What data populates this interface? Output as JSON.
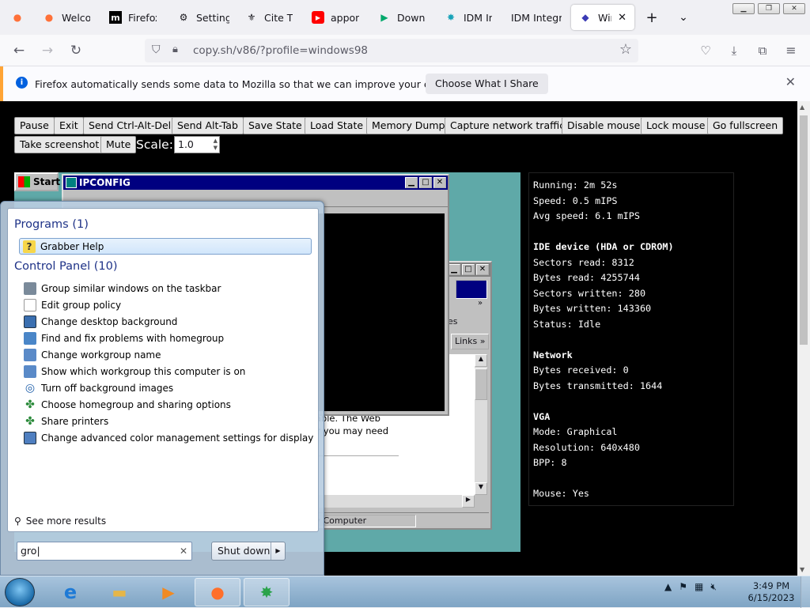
{
  "browser": {
    "tabs": [
      {
        "title": "",
        "icon": "firefox-icon",
        "active": false
      },
      {
        "title": "Welcom",
        "icon": "firefox-icon",
        "active": false
      },
      {
        "title": "Firefox",
        "icon": "mdn-icon",
        "active": false
      },
      {
        "title": "Settings",
        "icon": "gear-icon",
        "active": false
      },
      {
        "title": "Cite Th",
        "icon": "cite-icon",
        "active": false
      },
      {
        "title": "appon",
        "icon": "youtube-icon",
        "active": false
      },
      {
        "title": "Downlo",
        "icon": "play-icon",
        "active": false
      },
      {
        "title": "IDM Ini",
        "icon": "idm-icon",
        "active": false
      },
      {
        "title": "IDM Integra",
        "icon": "",
        "active": false
      },
      {
        "title": "Wind",
        "icon": "v86-icon",
        "active": true
      }
    ],
    "new_tab": "+",
    "url": "copy.sh/v86/?profile=windows98",
    "notification": {
      "message": "Firefox automatically sends some data to Mozilla so that we can improve your experience.",
      "button": "Choose What I Share"
    }
  },
  "emulator": {
    "controls": [
      "Pause",
      "Exit",
      "Send Ctrl-Alt-Del",
      "Send Alt-Tab",
      "Save State",
      "Load State",
      "Memory Dump",
      "Capture network traffic",
      "Disable mouse",
      "Lock mouse",
      "Go fullscreen",
      "Take screenshot",
      "Mute"
    ],
    "scale_label": "Scale:",
    "scale_value": "1.0",
    "win98": {
      "start_label": "Start",
      "ipconfig_title": "IPCONFIG",
      "links_label": "Links",
      "ie_text_1": "rently unavailable. The Web",
      "ie_text_2": "l difficulties, or you may need",
      "es_label": "es",
      "status_zone": "My Computer"
    },
    "stats": {
      "running": "Running: 2m 52s",
      "speed": "Speed: 0.5 mIPS",
      "avg_speed": "Avg speed: 6.1 mIPS",
      "ide_header": "IDE device (HDA or CDROM)",
      "sectors_read": "Sectors read: 8312",
      "bytes_read": "Bytes read: 4255744",
      "sectors_written": "Sectors written: 280",
      "bytes_written": "Bytes written: 143360",
      "status": "Status: Idle",
      "network_header": "Network",
      "bytes_received": "Bytes received: 0",
      "bytes_transmitted": "Bytes transmitted: 1644",
      "vga_header": "VGA",
      "mode": "Mode: Graphical",
      "resolution": "Resolution: 640x480",
      "bpp": "BPP: 8",
      "mouse": "Mouse: Yes"
    }
  },
  "start_menu": {
    "programs_header": "Programs (1)",
    "programs": [
      "Grabber Help"
    ],
    "control_panel_header": "Control Panel (10)",
    "control_panel_items": [
      "Group similar windows on the taskbar",
      "Edit group policy",
      "Change desktop background",
      "Find and fix problems with homegroup",
      "Change workgroup name",
      "Show which workgroup this computer is on",
      "Turn off background images",
      "Choose homegroup and sharing options",
      "Share printers",
      "Change advanced color management settings for displays, sca..."
    ],
    "see_more": "See more results",
    "search_value": "gro",
    "shutdown_label": "Shut down"
  },
  "taskbar": {
    "time": "3:49 PM",
    "date": "6/15/2023"
  }
}
